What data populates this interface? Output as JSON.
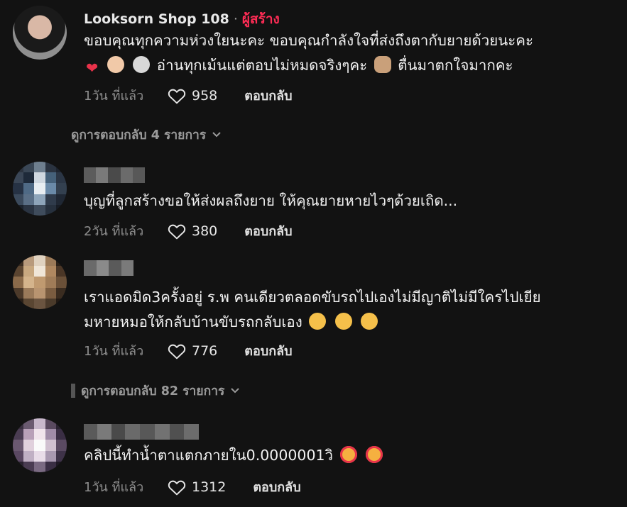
{
  "comments": [
    {
      "username": "Looksorn Shop 108",
      "separator": "·",
      "badge": "ผู้สร้าง",
      "text_line1": "ขอบคุณทุกความห่วงใยนะคะ ขอบคุณกำลังใจที่ส่งถึงตากับยายด้วยนะคะ",
      "text_line2": "อ่านทุกเม้นแต่ตอบไม่หมดจริงๆคะ",
      "text_line2b": "ตื่นมาตกใจมากคะ",
      "time": "1วัน ที่แล้ว",
      "likes": "958",
      "reply": "ตอบกลับ",
      "view_replies": "ดูการตอบกลับ 4 รายการ"
    },
    {
      "text": "บุญที่ลูกสร้างขอให้ส่งผลถึงยาย ให้คุณยายหายไวๆด้วยเถิด...",
      "time": "2วัน ที่แล้ว",
      "likes": "380",
      "reply": "ตอบกลับ"
    },
    {
      "text_line1": "เราแอดมิด3ครั้งอยู่ ร.พ คนเดียวตลอดขับรถไปเองไม่มีญาติไม่มีใครไปเยีย",
      "text_line2": "มหายหมอให้กลับบ้านขับรถกลับเอง",
      "time": "1วัน ที่แล้ว",
      "likes": "776",
      "reply": "ตอบกลับ",
      "view_replies": "ดูการตอบกลับ 82 รายการ"
    },
    {
      "text": "คลิปนี้ทำน้ำตาแตกภายใน0.0000001วิ",
      "time": "1วัน ที่แล้ว",
      "likes": "1312",
      "reply": "ตอบกลับ"
    }
  ],
  "colors": {
    "background": "#121212",
    "creator_badge": "#fe2c55",
    "muted_text": "#8d8d8d"
  },
  "icons": [
    "heart-outline-icon",
    "chevron-down-icon",
    "heart-emoji",
    "face-emoji",
    "flushed-face-emoji",
    "smiling-hearts-emoji",
    "person-bowing-emoji"
  ]
}
